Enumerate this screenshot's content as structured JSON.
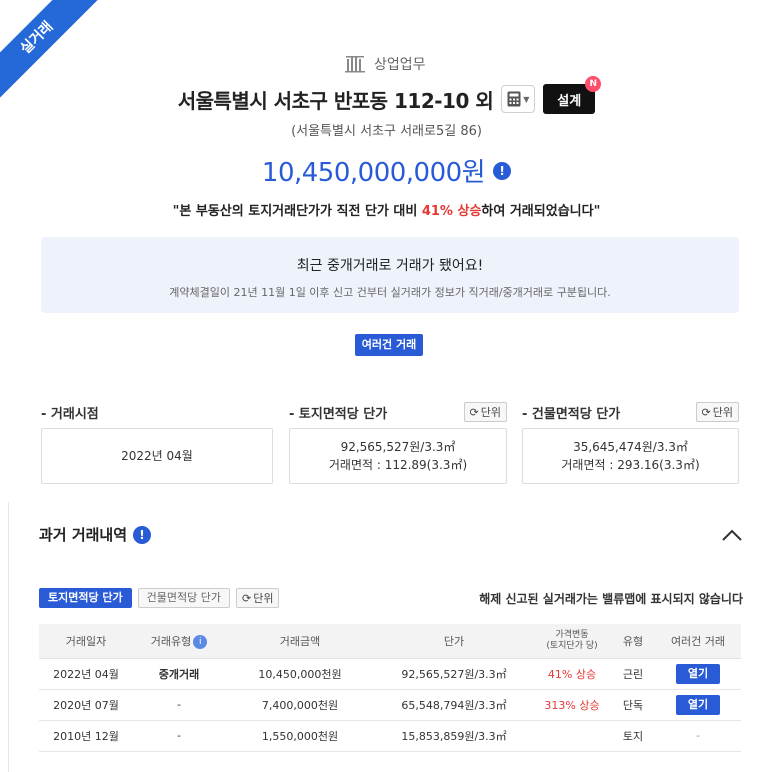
{
  "ribbon": "실거래",
  "category": "상업업무",
  "title": "서울특별시 서초구 반포동 112-10 외",
  "design_btn": "설계",
  "design_badge": "N",
  "subaddress": "(서울특별시 서초구 서래로5길 86)",
  "price": "10,450,000,000원",
  "quote": {
    "before": "\"본 부동산의 토지거래단가가 직전 단가 대비 ",
    "highlight": "41% 상승",
    "after": "하여 거래되었습니다\""
  },
  "notice": {
    "title": "최근 중개거래로 거래가 됐어요!",
    "sub": "계약체결일이 21년 11월 1일 이후 신고 건부터 실거래가 정보가 직거래/중개거래로 구분됩니다."
  },
  "multi_btn": "여러건 거래",
  "metrics": {
    "time": {
      "label": "- 거래시점",
      "value": "2022년 04월"
    },
    "land": {
      "label": "- 토지면적당 단가",
      "unit": "단위",
      "line1": "92,565,527원/3.3㎡",
      "line2": "거래면적 : 112.89(3.3㎡)"
    },
    "bldg": {
      "label": "- 건물면적당 단가",
      "unit": "단위",
      "line1": "35,645,474원/3.3㎡",
      "line2": "거래면적 : 293.16(3.3㎡)"
    }
  },
  "past": {
    "title": "과거 거래내역",
    "tabs": [
      "토지면적당 단가",
      "건물면적당 단가"
    ],
    "unit_btn": "단위",
    "hint": "해제 신고된 실거래가는 밸류맵에 표시되지 않습니다",
    "headers": [
      "거래일자",
      "거래유형",
      "거래금액",
      "단가",
      "가격변동",
      "(토지단가 당)",
      "유형",
      "여러건 거래"
    ],
    "rows": [
      {
        "date": "2022년 04월",
        "type": "중개거래",
        "amount": "10,450,000천원",
        "unit_price": "92,565,527원/3.3㎡",
        "change": "41% 상승",
        "kind": "근린",
        "multi": "열기"
      },
      {
        "date": "2020년 07월",
        "type": "-",
        "amount": "7,400,000천원",
        "unit_price": "65,548,794원/3.3㎡",
        "change": "313% 상승",
        "kind": "단독",
        "multi": "열기"
      },
      {
        "date": "2010년 12월",
        "type": "-",
        "amount": "1,550,000천원",
        "unit_price": "15,853,859원/3.3㎡",
        "change": "",
        "kind": "토지",
        "multi": "-"
      }
    ]
  },
  "colors": {
    "accent": "#2a5bd7",
    "up": "#e53935",
    "notice_bg": "#eef2fb"
  }
}
